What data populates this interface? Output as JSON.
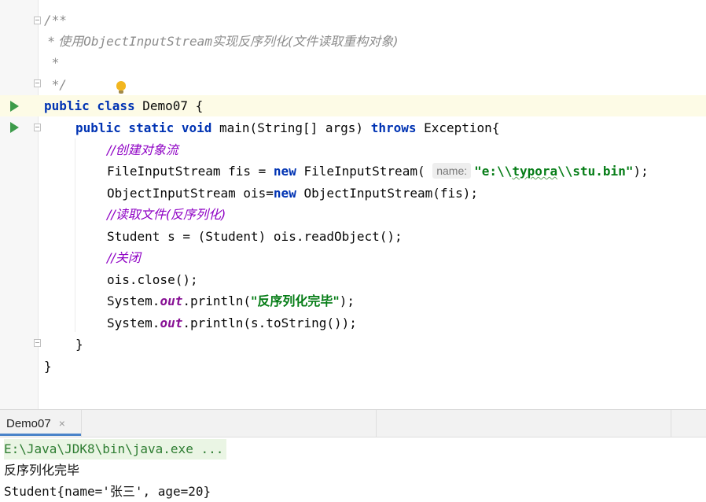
{
  "editor": {
    "lines": {
      "l1": "/**",
      "l2_prefix": " * 使用",
      "l2_mono": "ObjectInputStream",
      "l2_suffix": "实现反序列化(文件读取重构对象)",
      "l3": " *",
      "l4": " */",
      "l5_kw": "public class",
      "l5_rest": " Demo07 {",
      "l6_kw1": "public static void",
      "l6_mid": " main(String[] args) ",
      "l6_kw2": "throws",
      "l6_rest": " Exception{",
      "l7": "//创建对象流",
      "l8_pre": "FileInputStream fis = ",
      "l8_kw": "new",
      "l8_mid": " FileInputStream(",
      "l8_hint": "name:",
      "l8_str1": "\"e:\\\\",
      "l8_str2": "typora",
      "l8_str3": "\\\\stu.bin\"",
      "l8_end": ");",
      "l9_pre": "ObjectInputStream ois=",
      "l9_kw": "new",
      "l9_rest": " ObjectInputStream(fis);",
      "l10": "//读取文件(反序列化)",
      "l11": "Student s = (Student) ois.readObject();",
      "l12": "//关闭",
      "l13": "ois.close();",
      "l14_pre": "System.",
      "l14_field": "out",
      "l14_mid": ".println(",
      "l14_str": "\"反序列化完毕\"",
      "l14_end": ");",
      "l15_pre": "System.",
      "l15_field": "out",
      "l15_rest": ".println(s.toString());",
      "l16": "}",
      "l17": "}"
    }
  },
  "run_panel": {
    "tab_label": "Demo07",
    "tab_close": "×",
    "output": {
      "command": "E:\\Java\\JDK8\\bin\\java.exe ...",
      "line1": "反序列化完毕",
      "line2": "Student{name='张三', age=20}"
    }
  },
  "colors": {
    "keyword": "#0033b3",
    "string": "#067d17",
    "comment": "#8c8c8c",
    "chinese_comment": "#8e00c4",
    "run_icon": "#3d9b4a",
    "highlight_line": "#fdfbe6"
  }
}
